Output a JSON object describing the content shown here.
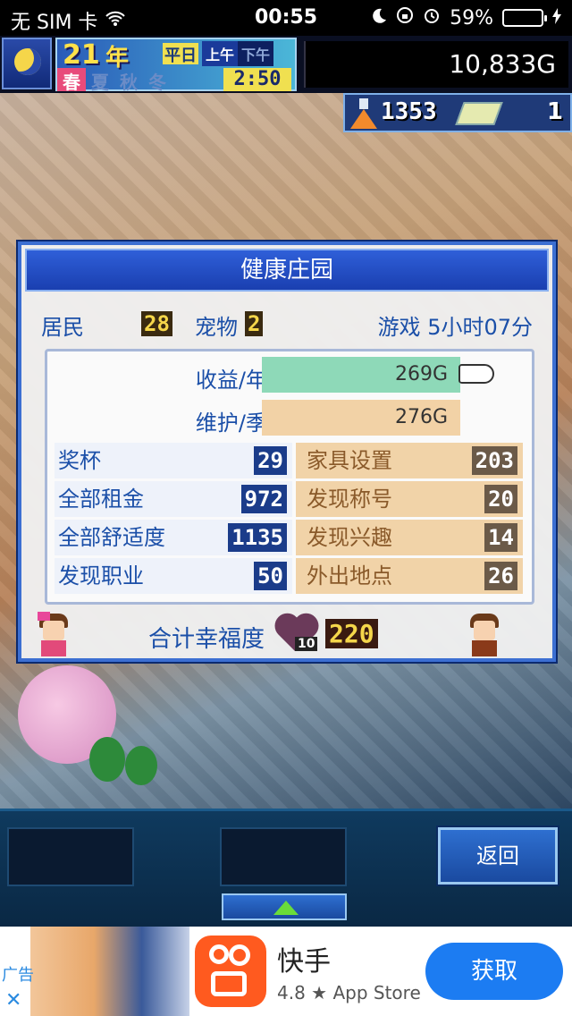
{
  "status_bar": {
    "carrier": "无 SIM 卡",
    "time": "00:55",
    "battery": "59%",
    "battery_level": 0.59
  },
  "hud": {
    "year_num": "21",
    "year_unit": "年",
    "seasons": [
      "春",
      "夏",
      "秋",
      "冬"
    ],
    "weekday": "平日",
    "am": "上午",
    "pm": "下午",
    "clock": "2:50",
    "money": "10,833G"
  },
  "resources": {
    "research": "1353",
    "tickets": "1"
  },
  "dialog": {
    "title": "健康庄园",
    "residents_label": "居民",
    "residents": "28",
    "pets_label": "宠物",
    "pets": "2",
    "play_time": "游戏 5小时07分",
    "income_label": "收益/年",
    "income": "269G",
    "upkeep_label": "维护/季",
    "upkeep": "276G",
    "stats_left": [
      {
        "label": "奖杯",
        "value": "29"
      },
      {
        "label": "全部租金",
        "value": "972"
      },
      {
        "label": "全部舒适度",
        "value": "1135"
      },
      {
        "label": "发现职业",
        "value": "50"
      }
    ],
    "stats_right": [
      {
        "label": "家具设置",
        "value": "203"
      },
      {
        "label": "发现称号",
        "value": "20"
      },
      {
        "label": "发现兴趣",
        "value": "14"
      },
      {
        "label": "外出地点",
        "value": "26"
      }
    ],
    "happiness_label": "合计幸福度",
    "heart_level": "10",
    "happiness": "220"
  },
  "bottom": {
    "back_label": "返回"
  },
  "ad": {
    "tag": "广告",
    "close": "✕",
    "app_name": "快手",
    "meta": "4.8 ★ App Store",
    "cta": "获取"
  },
  "colors": {
    "income_bar": "#8ed9b8",
    "upkeep_bar": "#f2d2a6",
    "accent": "#3c6fd2"
  }
}
